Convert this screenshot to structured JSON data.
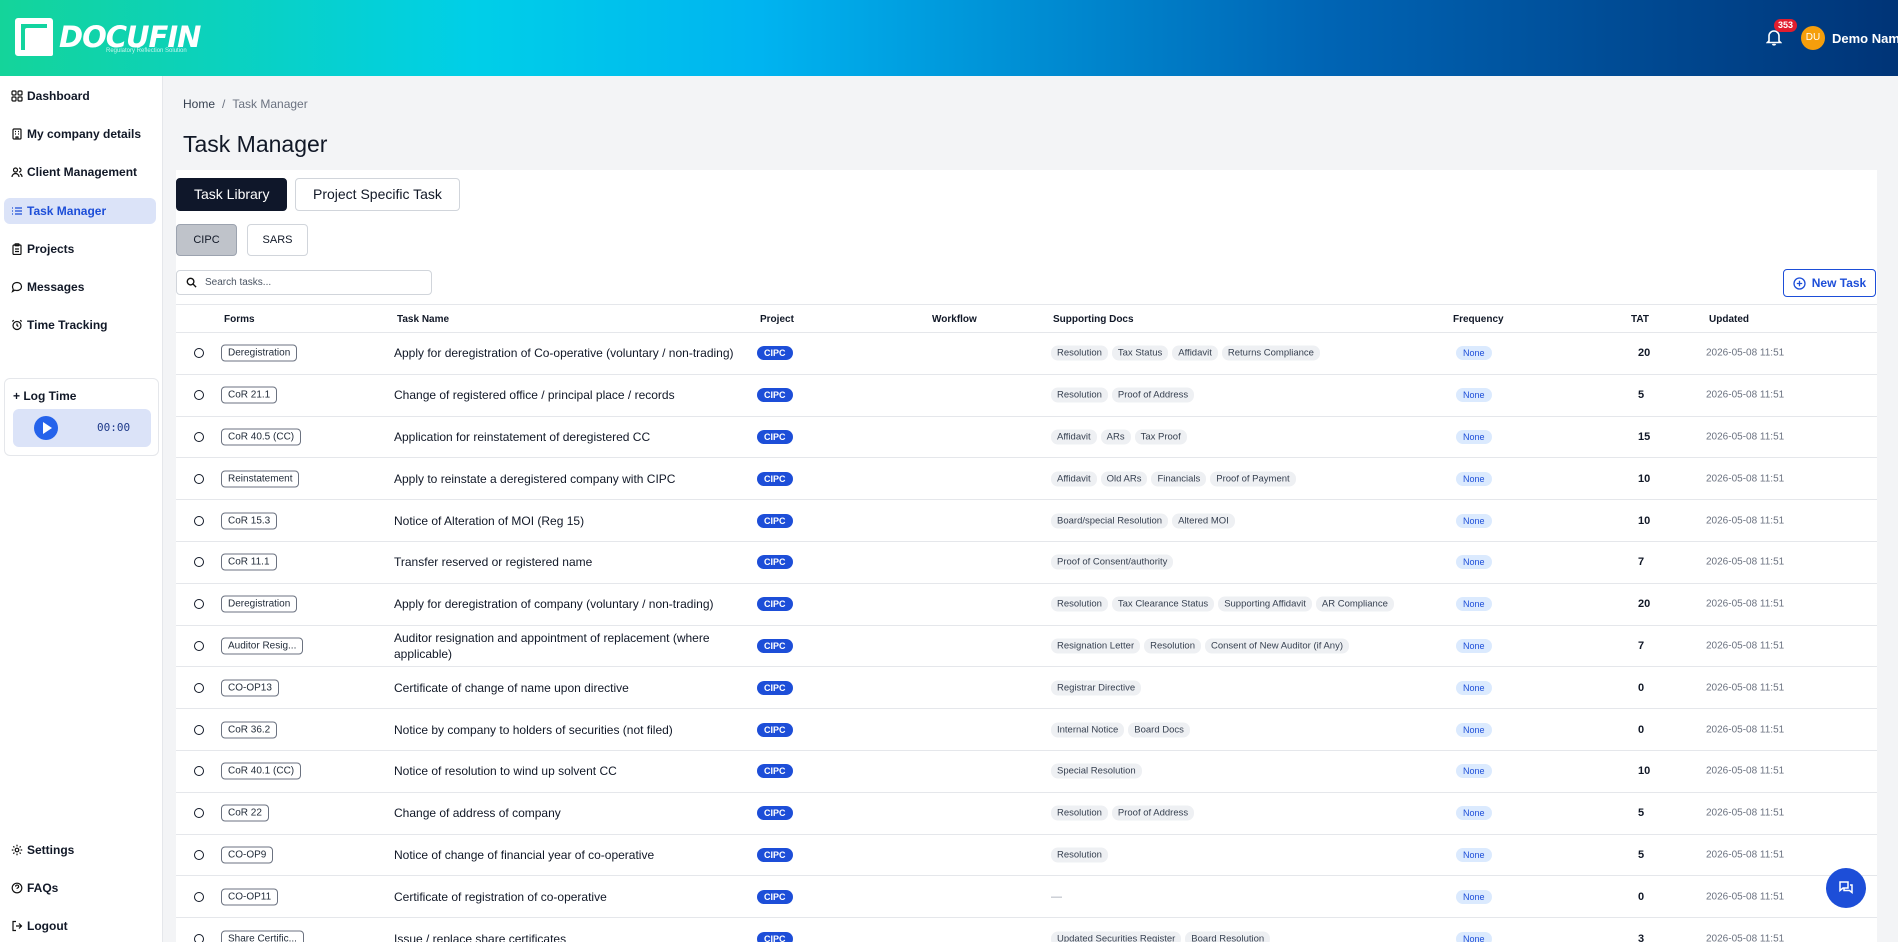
{
  "brand": {
    "name": "DOCUFIN",
    "tagline": "Regulatory Reflection Solution"
  },
  "header": {
    "notification_count": "353",
    "avatar_initials": "DU",
    "user_name": "Demo Name"
  },
  "sidebar": {
    "items": [
      {
        "label": "Dashboard",
        "icon": "grid-icon"
      },
      {
        "label": "My company details",
        "icon": "building-icon"
      },
      {
        "label": "Client Management",
        "icon": "users-icon"
      },
      {
        "label": "Task Manager",
        "icon": "list-icon",
        "active": true
      },
      {
        "label": "Projects",
        "icon": "clipboard-icon"
      },
      {
        "label": "Messages",
        "icon": "chat-icon"
      },
      {
        "label": "Time Tracking",
        "icon": "alarm-icon"
      }
    ],
    "log_time": {
      "title": "+ Log Time",
      "timer": "00:00"
    },
    "footer_items": [
      {
        "label": "Settings",
        "icon": "gear-icon"
      },
      {
        "label": "FAQs",
        "icon": "help-icon"
      },
      {
        "label": "Logout",
        "icon": "logout-icon"
      }
    ]
  },
  "breadcrumb": {
    "home": "Home",
    "separator": "/",
    "current": "Task Manager"
  },
  "page_title": "Task Manager",
  "tabs": [
    {
      "label": "Task Library",
      "active": true
    },
    {
      "label": "Project Specific Task",
      "active": false
    }
  ],
  "filters": [
    {
      "label": "CIPC",
      "active": true
    },
    {
      "label": "SARS",
      "active": false
    }
  ],
  "search": {
    "placeholder": "Search tasks...",
    "value": ""
  },
  "new_task_label": "New Task",
  "table": {
    "columns": [
      "Forms",
      "Task Name",
      "Project",
      "Workflow",
      "Supporting Docs",
      "Frequency",
      "TAT",
      "Updated"
    ],
    "rows": [
      {
        "form": "Deregistration",
        "name": "Apply for deregistration of Co-operative (voluntary / non-trading)",
        "project": "CIPC",
        "docs": [
          "Resolution",
          "Tax Status",
          "Affidavit",
          "Returns Compliance"
        ],
        "frequency": "None",
        "tat": "20",
        "updated": "2026-05-08 11:51"
      },
      {
        "form": "CoR 21.1",
        "name": "Change of registered office / principal place / records",
        "project": "CIPC",
        "docs": [
          "Resolution",
          "Proof of Address"
        ],
        "frequency": "None",
        "tat": "5",
        "updated": "2026-05-08 11:51"
      },
      {
        "form": "CoR 40.5 (CC)",
        "name": "Application for reinstatement of deregistered CC",
        "project": "CIPC",
        "docs": [
          "Affidavit",
          "ARs",
          "Tax Proof"
        ],
        "frequency": "None",
        "tat": "15",
        "updated": "2026-05-08 11:51"
      },
      {
        "form": "Reinstatement",
        "name": "Apply to reinstate a deregistered company with CIPC",
        "project": "CIPC",
        "docs": [
          "Affidavit",
          "Old ARs",
          "Financials",
          "Proof of Payment"
        ],
        "frequency": "None",
        "tat": "10",
        "updated": "2026-05-08 11:51"
      },
      {
        "form": "CoR 15.3",
        "name": "Notice of Alteration of MOI (Reg 15)",
        "project": "CIPC",
        "docs": [
          "Board/special Resolution",
          "Altered MOI"
        ],
        "frequency": "None",
        "tat": "10",
        "updated": "2026-05-08 11:51"
      },
      {
        "form": "CoR 11.1",
        "name": "Transfer reserved or registered name",
        "project": "CIPC",
        "docs": [
          "Proof of Consent/authority"
        ],
        "frequency": "None",
        "tat": "7",
        "updated": "2026-05-08 11:51"
      },
      {
        "form": "Deregistration",
        "name": "Apply for deregistration of company (voluntary / non-trading)",
        "project": "CIPC",
        "docs": [
          "Resolution",
          "Tax Clearance Status",
          "Supporting Affidavit",
          "AR Compliance"
        ],
        "frequency": "None",
        "tat": "20",
        "updated": "2026-05-08 11:51"
      },
      {
        "form": "Auditor Resig...",
        "name": "Auditor resignation and appointment of replacement (where applicable)",
        "project": "CIPC",
        "docs": [
          "Resignation Letter",
          "Resolution",
          "Consent of New Auditor (if Any)"
        ],
        "frequency": "None",
        "tat": "7",
        "updated": "2026-05-08 11:51"
      },
      {
        "form": "CO-OP13",
        "name": "Certificate of change of name upon directive",
        "project": "CIPC",
        "docs": [
          "Registrar Directive"
        ],
        "frequency": "None",
        "tat": "0",
        "updated": "2026-05-08 11:51"
      },
      {
        "form": "CoR 36.2",
        "name": "Notice by company to holders of securities (not filed)",
        "project": "CIPC",
        "docs": [
          "Internal Notice",
          "Board Docs"
        ],
        "frequency": "None",
        "tat": "0",
        "updated": "2026-05-08 11:51"
      },
      {
        "form": "CoR 40.1 (CC)",
        "name": "Notice of resolution to wind up solvent CC",
        "project": "CIPC",
        "docs": [
          "Special Resolution"
        ],
        "frequency": "None",
        "tat": "10",
        "updated": "2026-05-08 11:51"
      },
      {
        "form": "CoR 22",
        "name": "Change of address of company",
        "project": "CIPC",
        "docs": [
          "Resolution",
          "Proof of Address"
        ],
        "frequency": "None",
        "tat": "5",
        "updated": "2026-05-08 11:51"
      },
      {
        "form": "CO-OP9",
        "name": "Notice of change of financial year of co-operative",
        "project": "CIPC",
        "docs": [
          "Resolution"
        ],
        "frequency": "None",
        "tat": "5",
        "updated": "2026-05-08 11:51"
      },
      {
        "form": "CO-OP11",
        "name": "Certificate of registration of co-operative",
        "project": "CIPC",
        "docs": [],
        "frequency": "None",
        "tat": "0",
        "updated": "2026-05-08 11:51"
      },
      {
        "form": "Share Certific...",
        "name": "Issue / replace share certificates",
        "project": "CIPC",
        "docs": [
          "Updated Securities Register",
          "Board Resolution"
        ],
        "frequency": "None",
        "tat": "3",
        "updated": "2026-05-08 11:51"
      }
    ],
    "empty_docs_placeholder": "—"
  },
  "colors": {
    "accent": "#1d4ed8",
    "header_gradient_start": "#14d49a",
    "header_gradient_end": "#003477",
    "dark_tab": "#0f172a"
  }
}
